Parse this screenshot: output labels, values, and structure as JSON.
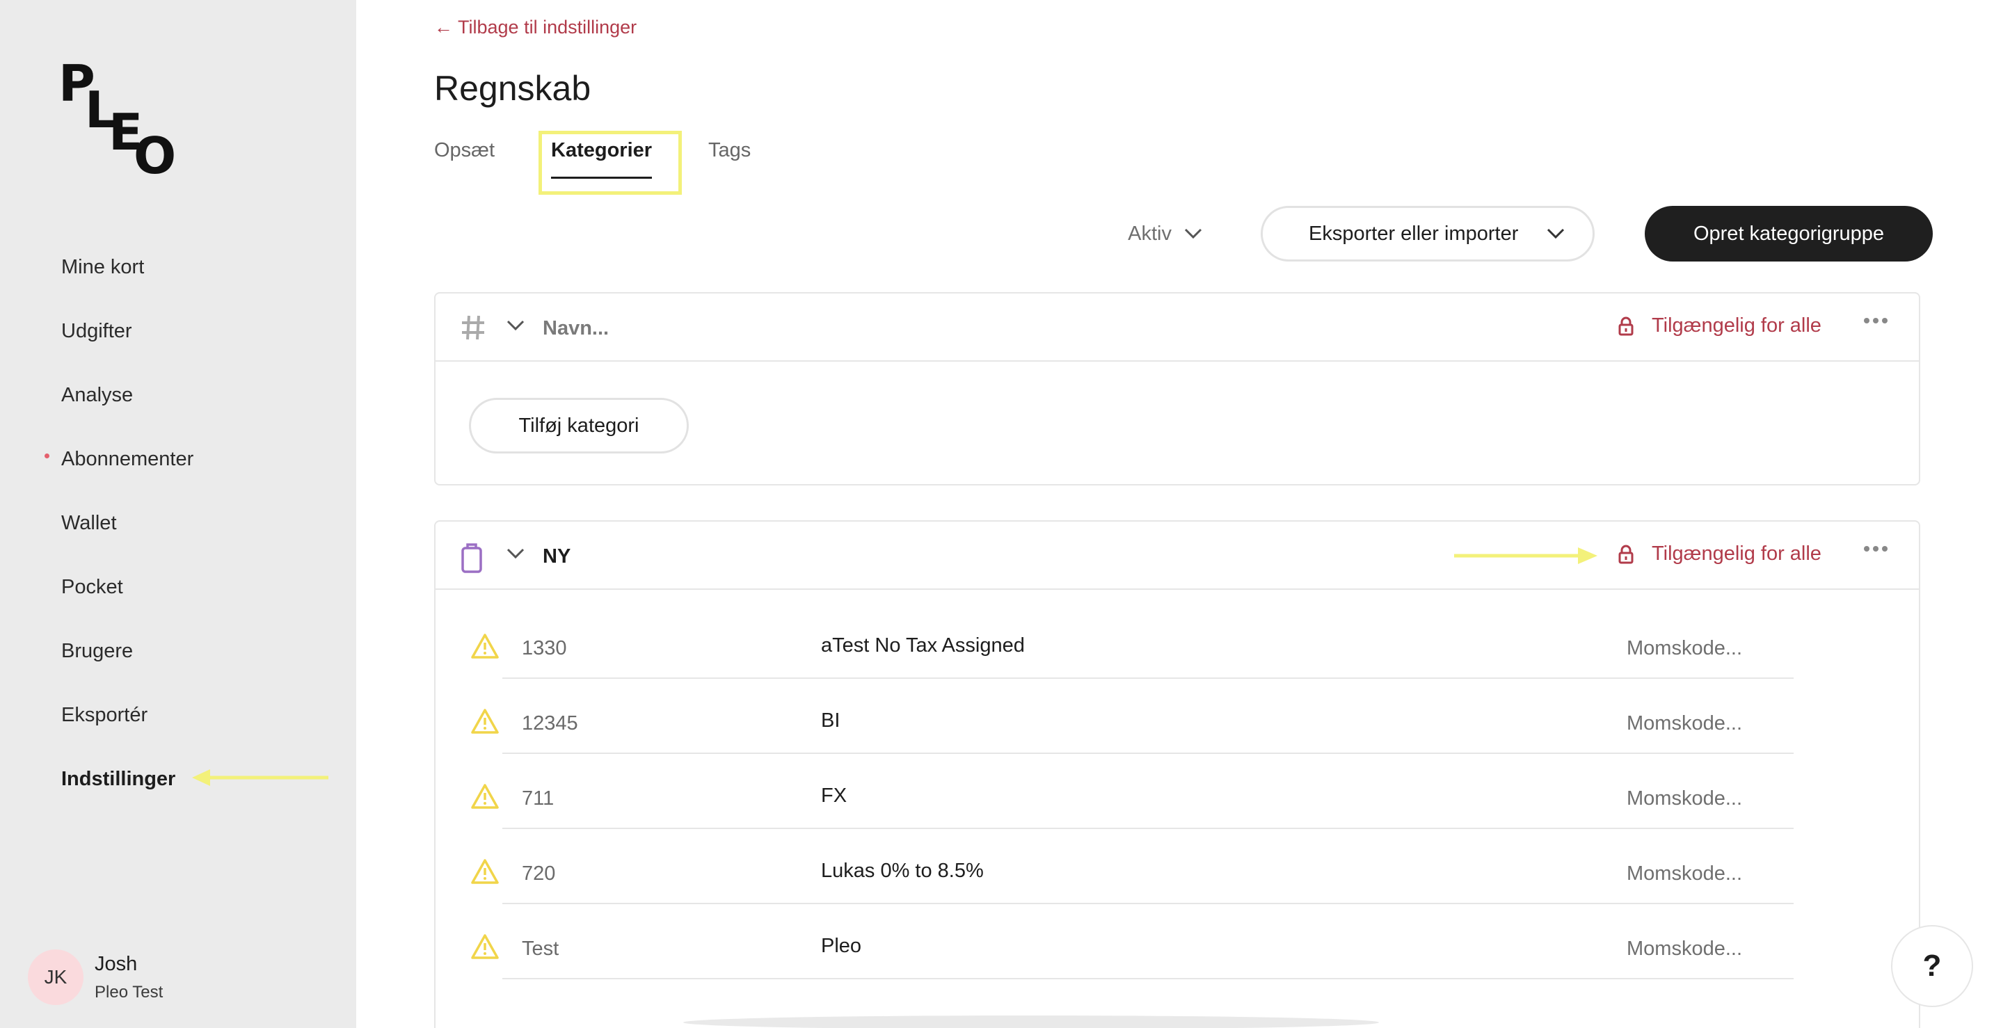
{
  "brand": {
    "logo_letters": [
      "P",
      "L",
      "E",
      "O"
    ]
  },
  "sidebar": {
    "items": [
      {
        "label": "Mine kort"
      },
      {
        "label": "Udgifter"
      },
      {
        "label": "Analyse"
      },
      {
        "label": "Abonnementer",
        "has_notification_dot": true
      },
      {
        "label": "Wallet"
      },
      {
        "label": "Pocket"
      },
      {
        "label": "Brugere"
      },
      {
        "label": "Eksportér"
      },
      {
        "label": "Indstillinger",
        "active": true
      }
    ]
  },
  "user": {
    "initials": "JK",
    "name": "Josh",
    "company": "Pleo Test"
  },
  "main": {
    "back_link": "← Tilbage til indstillinger",
    "title": "Regnskab",
    "tabs": [
      {
        "label": "Opsæt"
      },
      {
        "label": "Kategorier",
        "active": true
      },
      {
        "label": "Tags"
      }
    ],
    "filter_label": "Aktiv",
    "export_label": "Eksporter eller importer",
    "create_label": "Opret kategorigruppe",
    "groups": [
      {
        "icon": "hash-icon",
        "name_placeholder": "Navn...",
        "access": "Tilgængelig for alle",
        "add_category": "Tilføj kategori"
      },
      {
        "icon": "suitcase-icon",
        "name": "NY",
        "access": "Tilgængelig for alle",
        "rows": [
          {
            "code": "1330",
            "name": "aTest No Tax Assigned",
            "tax_placeholder": "Momskode..."
          },
          {
            "code": "12345",
            "name": "BI",
            "tax_placeholder": "Momskode..."
          },
          {
            "code": "711",
            "name": "FX",
            "tax_placeholder": "Momskode..."
          },
          {
            "code": "720",
            "name": "Lukas 0% to 8.5%",
            "tax_placeholder": "Momskode..."
          },
          {
            "code": "Test",
            "name": "Pleo",
            "tax_placeholder": "Momskode..."
          }
        ]
      }
    ]
  },
  "help_label": "?",
  "colors": {
    "sidebar_bg": "#ebebeb",
    "accent_red": "#b13b4a",
    "primary_button": "#1f1f1f",
    "annotation_yellow": "#f3f17a",
    "warning_yellow": "#f1d54a",
    "suitcase_purple": "#9b6fc4"
  }
}
